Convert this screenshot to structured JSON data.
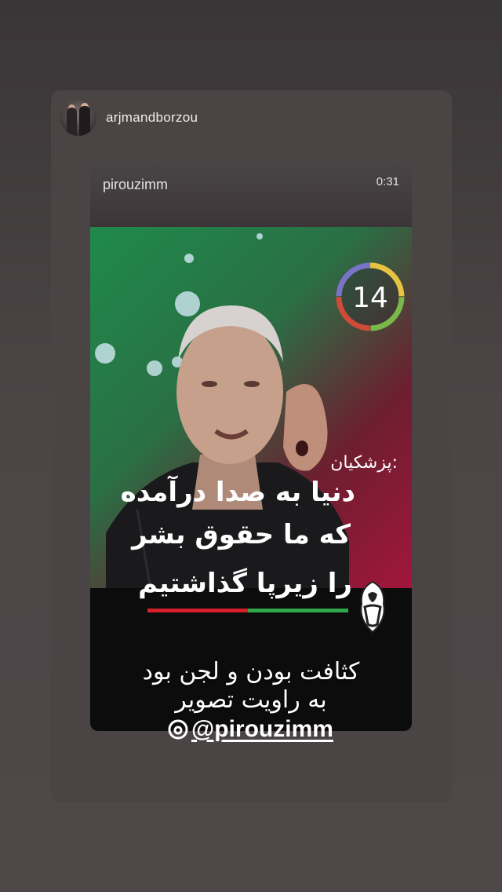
{
  "story": {
    "username": "arjmandborzou"
  },
  "shared_post": {
    "username": "pirouzimm",
    "duration": "0:31",
    "clock_number": "14",
    "overlay": {
      "name": "پزشکیان:",
      "line1": "دنیا به صدا درآمده",
      "line2": "که ما حقوق بشر",
      "line3": "را زیرپا گذاشتیم"
    },
    "flag_colors": [
      "#d51f2b",
      "#ffffff",
      "#2ea84a"
    ]
  },
  "comment": {
    "line1": "کثافت بودن و لجن بود",
    "line2": "به راویت تصویر",
    "mention": "@pirouzimm"
  }
}
